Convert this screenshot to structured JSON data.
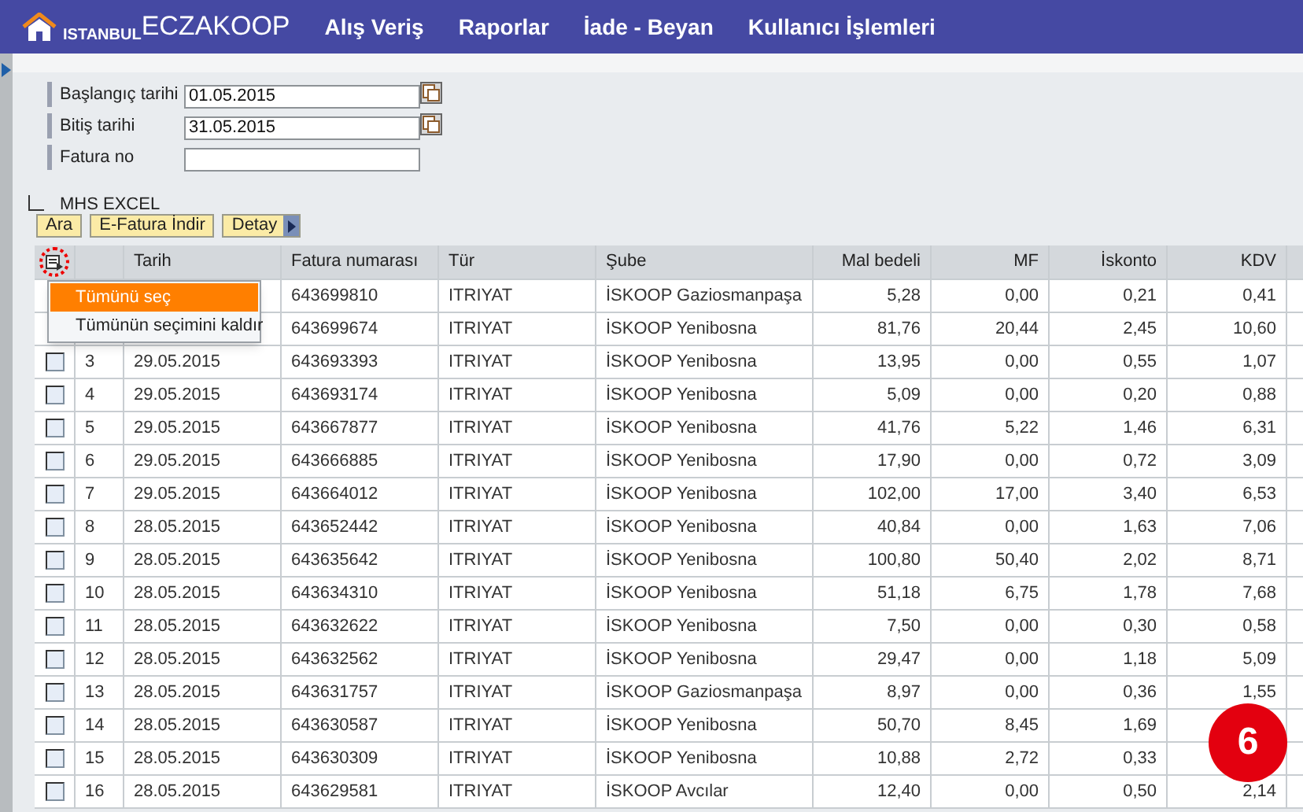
{
  "header": {
    "logo_left": "ISTANBUL",
    "logo_right": "ECZAKOOP",
    "nav": [
      "Alış Veriş",
      "Raporlar",
      "İade - Beyan",
      "Kullanıcı İşlemleri"
    ]
  },
  "form": [
    {
      "label": "Başlangıç tarihi",
      "value": "01.05.2015",
      "calendar": true
    },
    {
      "label": "Bitiş tarihi",
      "value": "31.05.2015",
      "calendar": true
    },
    {
      "label": "Fatura no",
      "calendar": false
    }
  ],
  "excel": {
    "label": "MHS EXCEL",
    "checked": false
  },
  "buttons": [
    "Ara",
    "E-Fatura İndir",
    "Detay"
  ],
  "table": {
    "columns": [
      "Tarih",
      "Fatura numarası",
      "Tür",
      "Şube",
      "Mal bedeli",
      "MF",
      "İskonto",
      "KDV"
    ],
    "rows": [
      {
        "invoice": "643699810",
        "type": "ITRIYAT",
        "branch": "İSKOOP Gaziosmanpaşa",
        "amount": "5,28",
        "mf": "0,00",
        "discount": "0,21",
        "vat": "0,41"
      },
      {
        "invoice": "643699674",
        "type": "ITRIYAT",
        "branch": "İSKOOP Yenibosna",
        "amount": "81,76",
        "mf": "20,44",
        "discount": "2,45",
        "vat": "10,60"
      },
      {
        "selected": false,
        "no": "3",
        "date": "29.05.2015",
        "invoice": "643693393",
        "type": "ITRIYAT",
        "branch": "İSKOOP Yenibosna",
        "amount": "13,95",
        "mf": "0,00",
        "discount": "0,55",
        "vat": "1,07"
      },
      {
        "selected": false,
        "no": "4",
        "date": "29.05.2015",
        "invoice": "643693174",
        "type": "ITRIYAT",
        "branch": "İSKOOP Yenibosna",
        "amount": "5,09",
        "mf": "0,00",
        "discount": "0,20",
        "vat": "0,88"
      },
      {
        "selected": false,
        "no": "5",
        "date": "29.05.2015",
        "invoice": "643667877",
        "type": "ITRIYAT",
        "branch": "İSKOOP Yenibosna",
        "amount": "41,76",
        "mf": "5,22",
        "discount": "1,46",
        "vat": "6,31"
      },
      {
        "selected": false,
        "no": "6",
        "date": "29.05.2015",
        "invoice": "643666885",
        "type": "ITRIYAT",
        "branch": "İSKOOP Yenibosna",
        "amount": "17,90",
        "mf": "0,00",
        "discount": "0,72",
        "vat": "3,09"
      },
      {
        "selected": false,
        "no": "7",
        "date": "29.05.2015",
        "invoice": "643664012",
        "type": "ITRIYAT",
        "branch": "İSKOOP Yenibosna",
        "amount": "102,00",
        "mf": "17,00",
        "discount": "3,40",
        "vat": "6,53"
      },
      {
        "selected": false,
        "no": "8",
        "date": "28.05.2015",
        "invoice": "643652442",
        "type": "ITRIYAT",
        "branch": "İSKOOP Yenibosna",
        "amount": "40,84",
        "mf": "0,00",
        "discount": "1,63",
        "vat": "7,06"
      },
      {
        "selected": false,
        "no": "9",
        "date": "28.05.2015",
        "invoice": "643635642",
        "type": "ITRIYAT",
        "branch": "İSKOOP Yenibosna",
        "amount": "100,80",
        "mf": "50,40",
        "discount": "2,02",
        "vat": "8,71"
      },
      {
        "selected": false,
        "no": "10",
        "date": "28.05.2015",
        "invoice": "643634310",
        "type": "ITRIYAT",
        "branch": "İSKOOP Yenibosna",
        "amount": "51,18",
        "mf": "6,75",
        "discount": "1,78",
        "vat": "7,68"
      },
      {
        "selected": false,
        "no": "11",
        "date": "28.05.2015",
        "invoice": "643632622",
        "type": "ITRIYAT",
        "branch": "İSKOOP Yenibosna",
        "amount": "7,50",
        "mf": "0,00",
        "discount": "0,30",
        "vat": "0,58"
      },
      {
        "selected": false,
        "no": "12",
        "date": "28.05.2015",
        "invoice": "643632562",
        "type": "ITRIYAT",
        "branch": "İSKOOP Yenibosna",
        "amount": "29,47",
        "mf": "0,00",
        "discount": "1,18",
        "vat": "5,09"
      },
      {
        "selected": false,
        "no": "13",
        "date": "28.05.2015",
        "invoice": "643631757",
        "type": "ITRIYAT",
        "branch": "İSKOOP Gaziosmanpaşa",
        "amount": "8,97",
        "mf": "0,00",
        "discount": "0,36",
        "vat": "1,55"
      },
      {
        "selected": false,
        "no": "14",
        "date": "28.05.2015",
        "invoice": "643630587",
        "type": "ITRIYAT",
        "branch": "İSKOOP Yenibosna",
        "amount": "50,70",
        "mf": "8,45",
        "discount": "1,69"
      },
      {
        "selected": false,
        "no": "15",
        "date": "28.05.2015",
        "invoice": "643630309",
        "type": "ITRIYAT",
        "branch": "İSKOOP Yenibosna",
        "amount": "10,88",
        "mf": "2,72",
        "discount": "0,33"
      },
      {
        "selected": false,
        "no": "16",
        "date": "28.05.2015",
        "invoice": "643629581",
        "type": "ITRIYAT",
        "branch": "İSKOOP Avcılar",
        "amount": "12,40",
        "mf": "0,00",
        "discount": "0,50",
        "vat": "2,14"
      }
    ]
  },
  "select_menu": [
    {
      "label": "Tümünü seç",
      "selected": true
    },
    {
      "label": "Tümünün seçimini kaldır",
      "selected": false
    }
  ],
  "step_badge": "6"
}
